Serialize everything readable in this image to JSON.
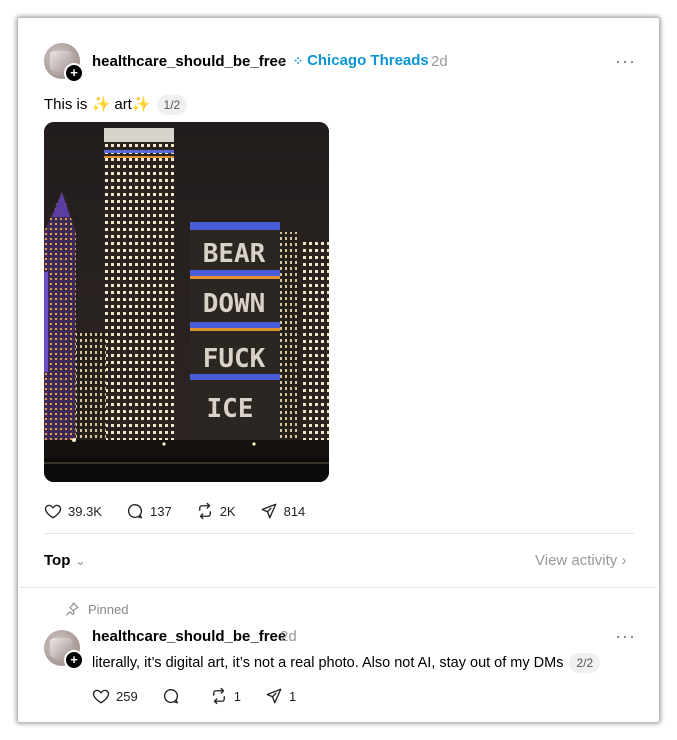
{
  "post": {
    "username": "healthcare_should_be_free",
    "community": "Chicago Threads",
    "age": "2d",
    "text": "This is ✨ art✨",
    "counter": "1/2",
    "more_label": "···",
    "image_sign_lines": [
      "BEAR",
      "DOWN",
      "FUCK",
      "ICE"
    ],
    "stats": {
      "likes": "39.3K",
      "replies": "137",
      "reposts": "2K",
      "shares": "814"
    }
  },
  "sort": {
    "label": "Top",
    "view_activity": "View activity"
  },
  "reply": {
    "pinned_label": "Pinned",
    "username": "healthcare_should_be_free",
    "age": "2d",
    "text": "literally, it’s digital art, it’s not a real photo. Also not AI, stay out of my DMs",
    "counter": "2/2",
    "more_label": "···",
    "stats": {
      "likes": "259",
      "replies": "",
      "reposts": "1",
      "shares": "1"
    }
  },
  "colors": {
    "community": "#0a95d6",
    "muted": "#999999",
    "divider": "#e4e4e4"
  }
}
